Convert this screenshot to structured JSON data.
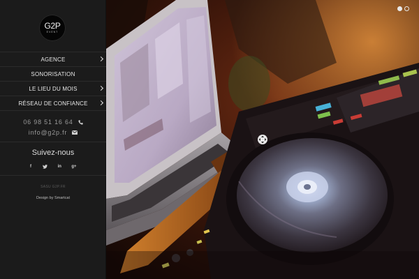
{
  "logo": {
    "main": "G2P",
    "sub": "EVENT"
  },
  "menu": {
    "items": [
      {
        "label": "AGENCE",
        "has_submenu": true
      },
      {
        "label": "SONORISATION",
        "has_submenu": false
      },
      {
        "label": "LE LIEU DU MOIS",
        "has_submenu": true
      },
      {
        "label": "RÉSEAU DE CONFIANCE",
        "has_submenu": true
      }
    ]
  },
  "contact": {
    "phone": "06 98 51 16 64",
    "phone_icon": "phone-icon",
    "email": "info@g2p.fr",
    "email_icon": "mail-icon"
  },
  "social": {
    "title": "Suivez-nous",
    "links": [
      {
        "icon": "facebook-icon",
        "glyph": "f"
      },
      {
        "icon": "twitter-icon",
        "glyph": "t"
      },
      {
        "icon": "linkedin-icon",
        "glyph": "in"
      },
      {
        "icon": "googleplus-icon",
        "glyph": "g+"
      }
    ]
  },
  "footer": {
    "company": "SASU G2P.FR",
    "credit": "Design by Smartcat"
  },
  "slider": {
    "slide_count": 2,
    "active_index": 0
  },
  "colors": {
    "sidebar_bg": "#1b1b1b",
    "accent_text": "#e6e6e6",
    "muted_text": "#9a9a9a"
  }
}
